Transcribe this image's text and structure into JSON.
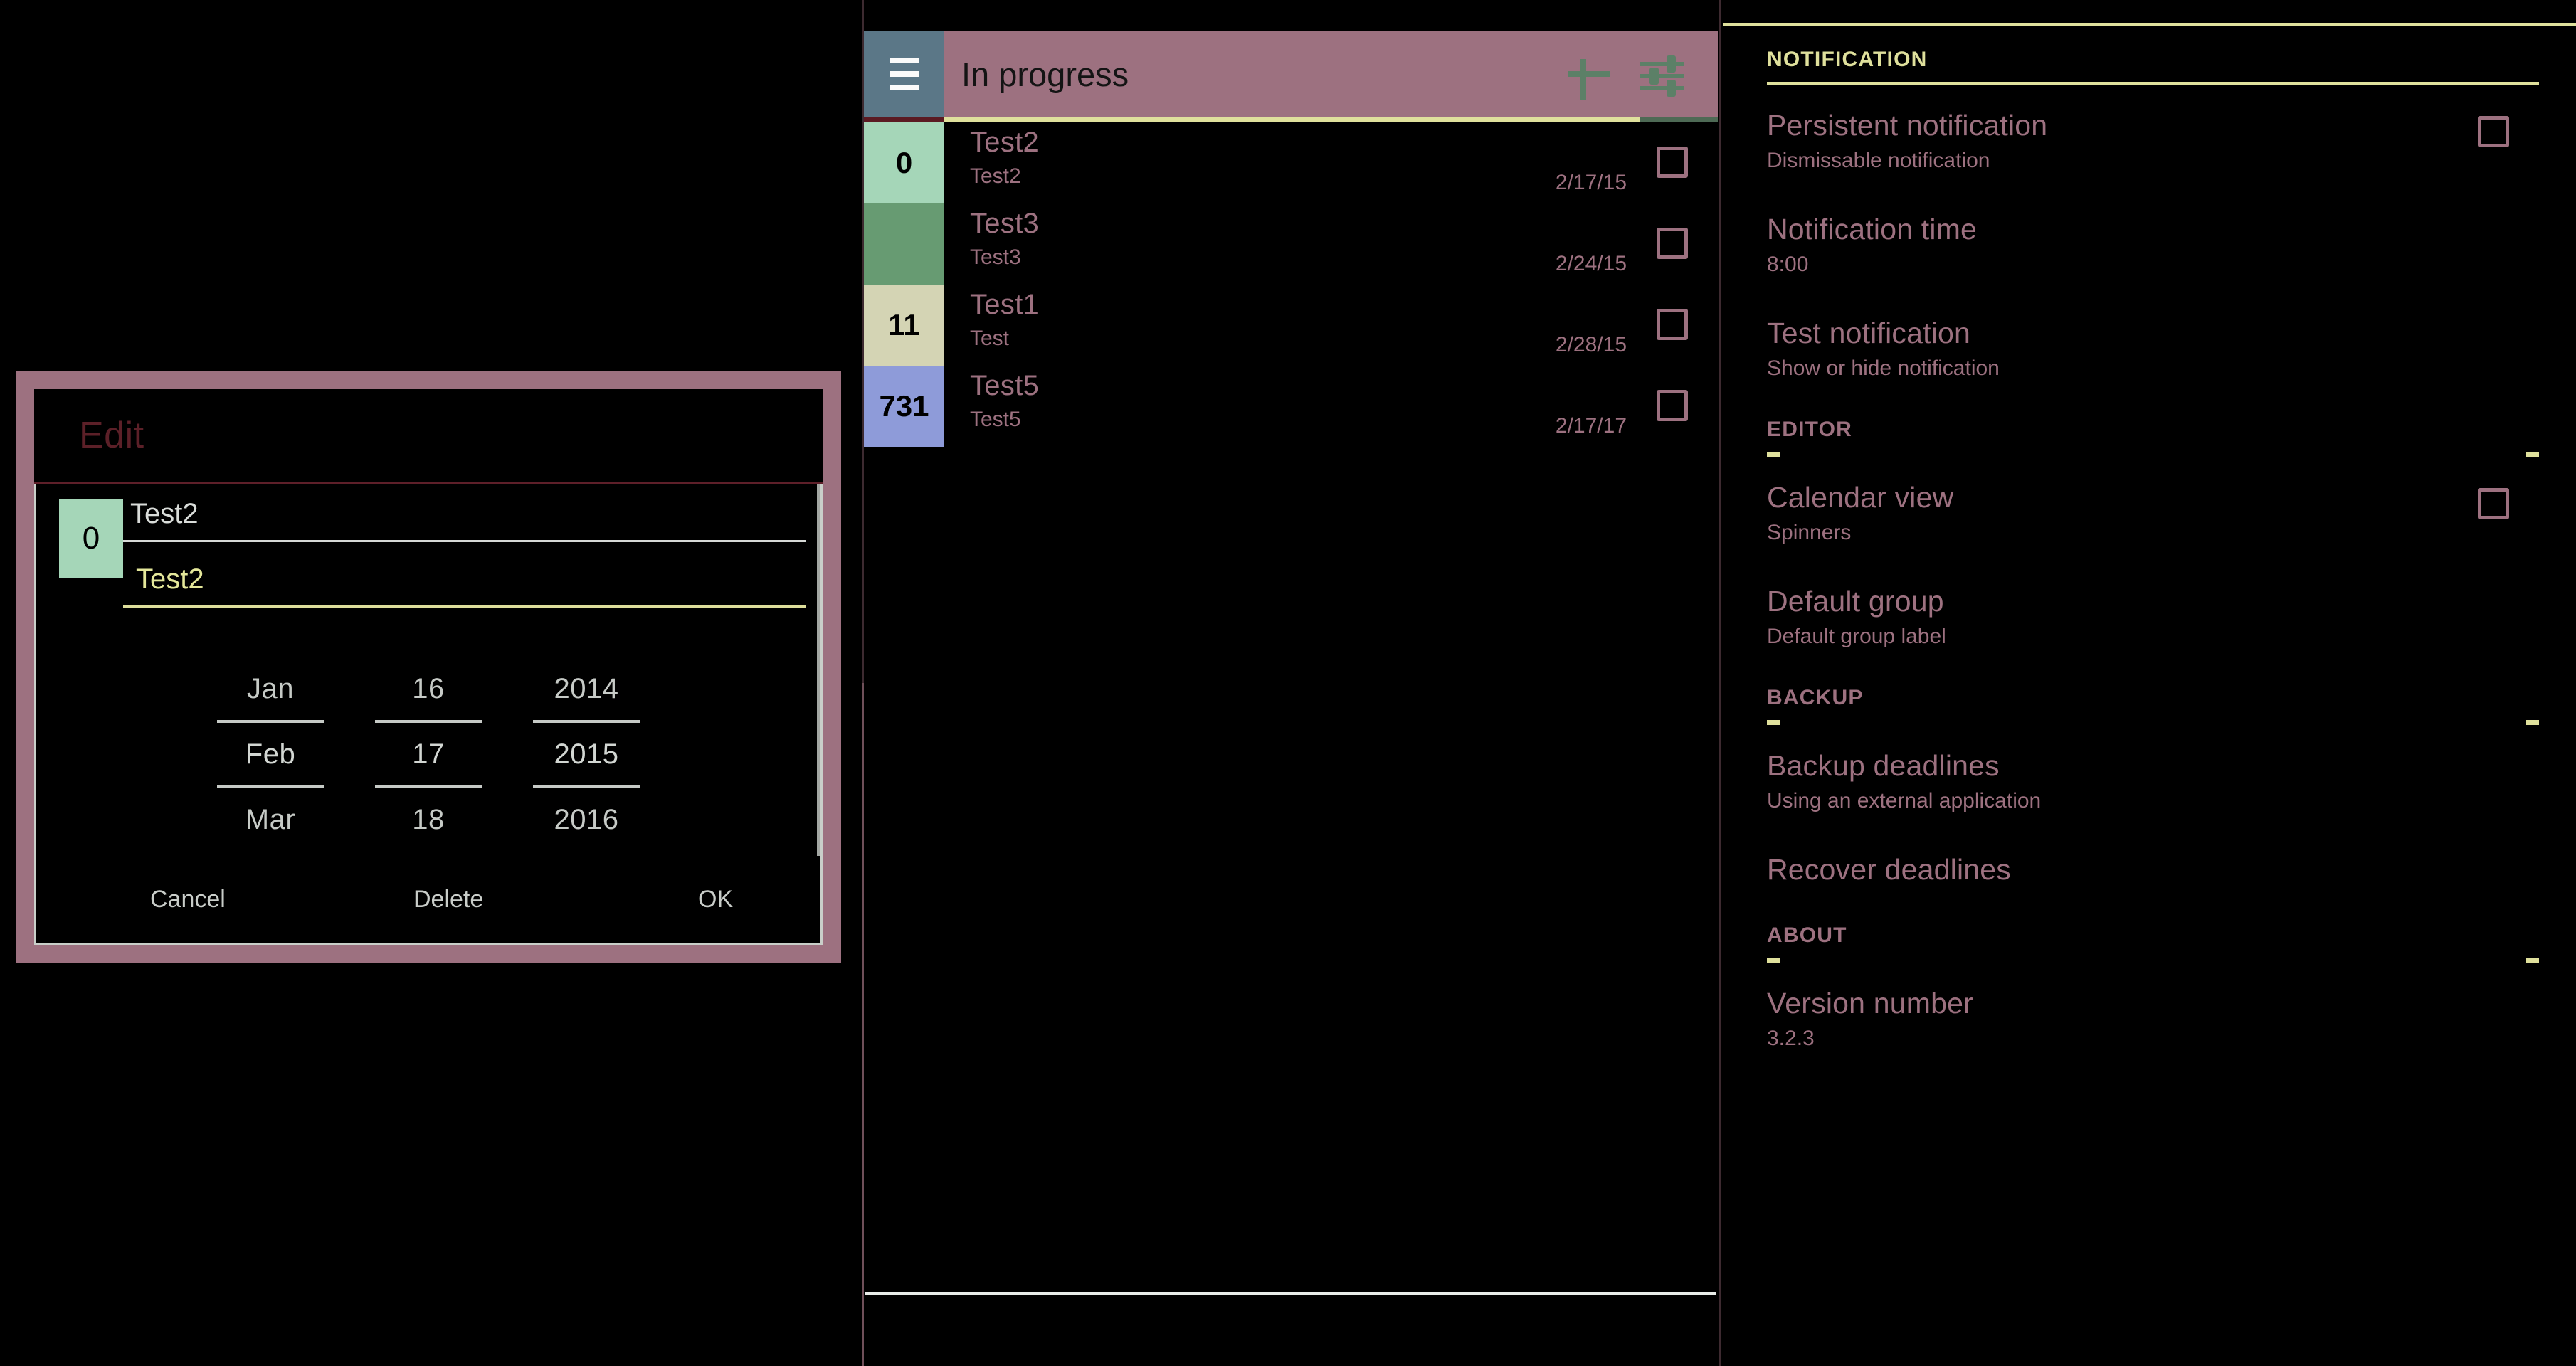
{
  "edit_dialog": {
    "title": "Edit",
    "badge_value": "0",
    "title_field_value": "Test2",
    "sub_field_value": "Test2",
    "date_picker": {
      "month": {
        "prev": "Jan",
        "current": "Feb",
        "next": "Mar"
      },
      "day": {
        "prev": "16",
        "current": "17",
        "next": "18"
      },
      "year": {
        "prev": "2014",
        "current": "2015",
        "next": "2016"
      }
    },
    "buttons": {
      "cancel": "Cancel",
      "delete": "Delete",
      "ok": "OK"
    }
  },
  "list_panel": {
    "toolbar": {
      "menu_icon": "hamburger-menu-icon",
      "title": "In progress",
      "add_icon": "plus-icon",
      "filter_icon": "sliders-icon"
    },
    "tasks": [
      {
        "badge": "0",
        "badge_color": "#a5d6b8",
        "title": "Test2",
        "subtitle": "Test2",
        "date": "2/17/15",
        "checked": false
      },
      {
        "badge": "",
        "badge_color": "#679b72",
        "title": "Test3",
        "subtitle": "Test3",
        "date": "2/24/15",
        "checked": false
      },
      {
        "badge": "11",
        "badge_color": "#d4d4b4",
        "title": "Test1",
        "subtitle": "Test",
        "date": "2/28/15",
        "checked": false
      },
      {
        "badge": "731",
        "badge_color": "#8e9bd9",
        "title": "Test5",
        "subtitle": "Test5",
        "date": "2/17/17",
        "checked": false
      }
    ]
  },
  "settings_panel": {
    "sections": [
      {
        "header": "NOTIFICATION",
        "style": "first",
        "items": [
          {
            "title": "Persistent notification",
            "summary": "Dismissable notification",
            "checkbox": true,
            "checked": false
          },
          {
            "title": "Notification time",
            "summary": "8:00",
            "checkbox": false,
            "checked": false
          },
          {
            "title": "Test notification",
            "summary": "Show or hide notification",
            "checkbox": false,
            "checked": false
          }
        ]
      },
      {
        "header": "EDITOR",
        "style": "rest",
        "items": [
          {
            "title": "Calendar view",
            "summary": "Spinners",
            "checkbox": true,
            "checked": false
          },
          {
            "title": "Default group",
            "summary": "Default group label",
            "checkbox": false,
            "checked": false
          }
        ]
      },
      {
        "header": "BACKUP",
        "style": "rest",
        "items": [
          {
            "title": "Backup deadlines",
            "summary": "Using an external application",
            "checkbox": false,
            "checked": false
          },
          {
            "title": "Recover deadlines",
            "summary": "",
            "checkbox": false,
            "checked": false
          }
        ]
      },
      {
        "header": "ABOUT",
        "style": "rest",
        "items": [
          {
            "title": "Version number",
            "summary": "3.2.3",
            "checkbox": false,
            "checked": false
          }
        ]
      }
    ]
  },
  "colors": {
    "accent_rose": "#9d7180",
    "accent_yellow": "#dfe09c",
    "dialog_title": "#5c2028",
    "menu_button": "#5b7787",
    "icon_green": "#5c8067"
  }
}
